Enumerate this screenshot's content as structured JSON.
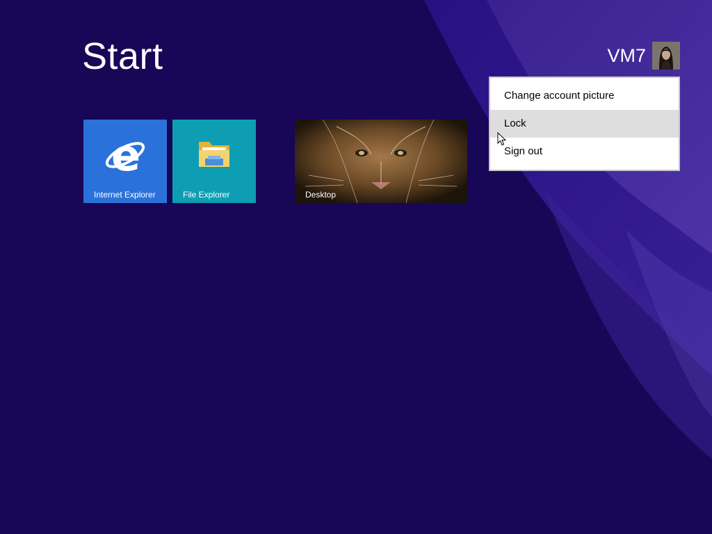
{
  "screen": {
    "title": "Start",
    "background_color": "#180657",
    "accent_color": "#4a2fa0"
  },
  "user": {
    "name": "VM7",
    "avatar_icon": "user-avatar-photo"
  },
  "tiles": [
    {
      "label": "Internet Explorer",
      "icon": "internet-explorer-icon",
      "color": "#2a72d9"
    },
    {
      "label": "File Explorer",
      "icon": "folder-icon",
      "color": "#0d9eb3"
    },
    {
      "label": "Desktop",
      "icon": "desktop-wallpaper",
      "color": "#3a2a16"
    }
  ],
  "account_menu": {
    "items": [
      {
        "label": "Change account picture"
      },
      {
        "label": "Lock",
        "state": "hover"
      },
      {
        "label": "Sign out"
      }
    ]
  }
}
